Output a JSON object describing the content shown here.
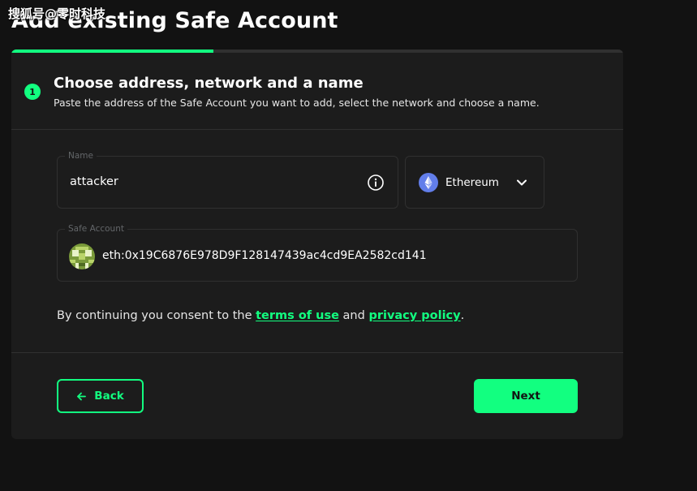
{
  "watermark": "搜狐号@零时科技",
  "page_title": "Add existing Safe Account",
  "progress": {
    "fraction": 0.33
  },
  "step": {
    "number": "1",
    "title": "Choose address, network and a name",
    "subtitle": "Paste the address of the Safe Account you want to add, select the network and choose a name."
  },
  "name_field": {
    "label": "Name",
    "value": "attacker"
  },
  "network_select": {
    "selected": "Ethereum"
  },
  "safe_account_field": {
    "label": "Safe Account",
    "value": "eth:0x19C6876E978D9F128147439ac4cd9EA2582cd141"
  },
  "consent": {
    "prefix": "By continuing you consent to the ",
    "terms_link": "terms of use",
    "middle": " and ",
    "privacy_link": "privacy policy",
    "suffix": "."
  },
  "buttons": {
    "back": "Back",
    "next": "Next"
  },
  "colors": {
    "accent": "#12ff80",
    "background": "#121212",
    "card": "#1c1c1c",
    "border": "#303030"
  },
  "icons": [
    "step-badge",
    "info-icon",
    "ethereum-logo-icon",
    "chevron-down-icon",
    "identicon-avatar",
    "arrow-left-icon"
  ]
}
